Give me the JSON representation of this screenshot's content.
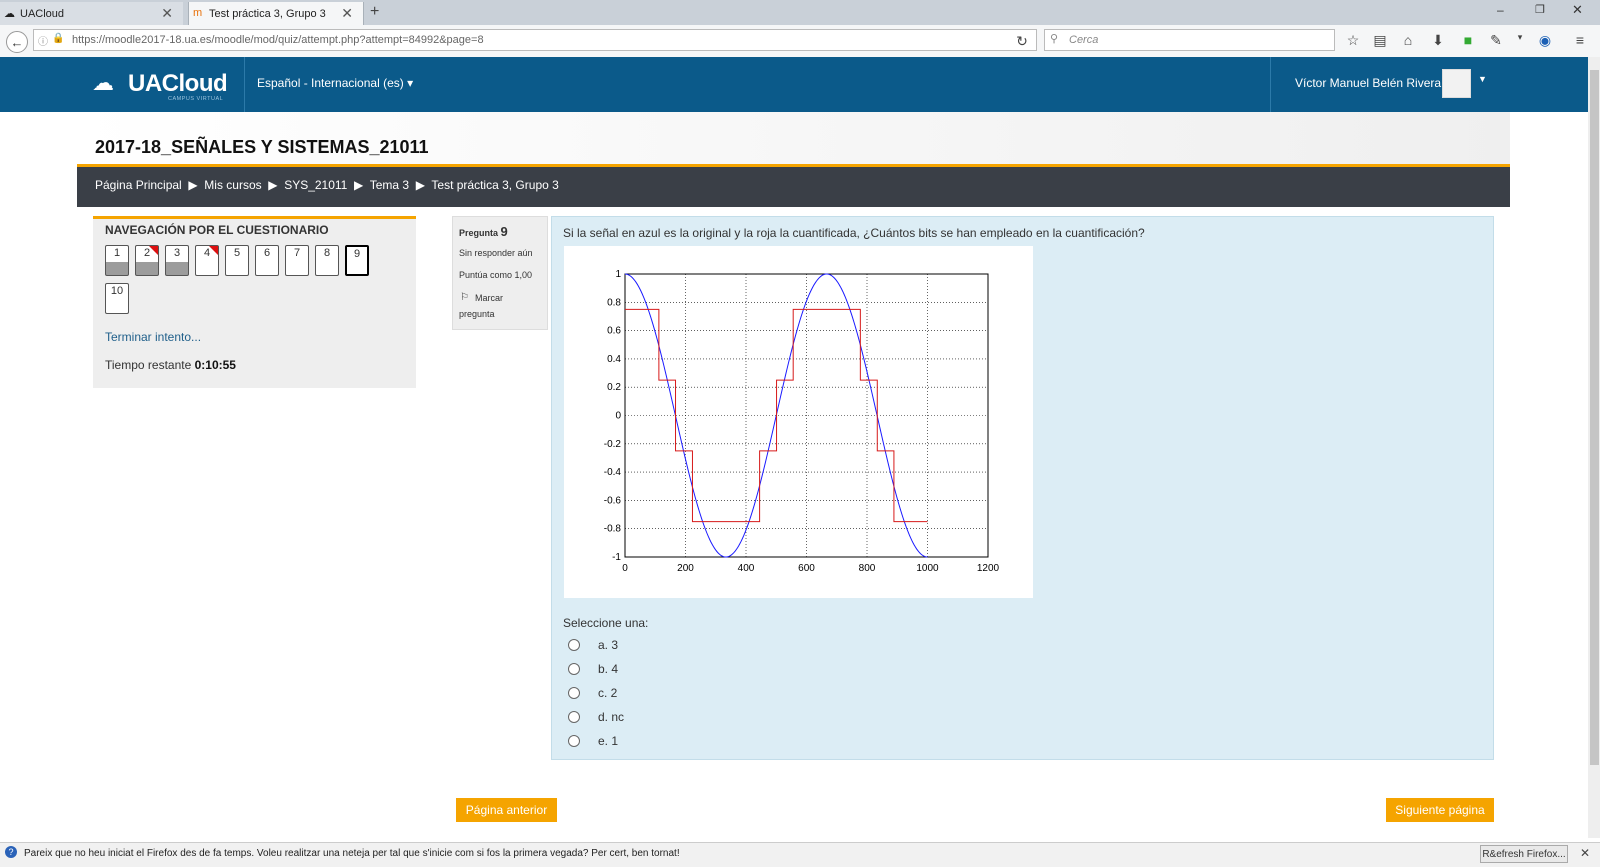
{
  "browser": {
    "tabs": [
      {
        "label": "UACloud",
        "active": false
      },
      {
        "label": "Test práctica 3, Grupo 3",
        "active": true
      }
    ],
    "url": "https://moodle2017-18.ua.es/moodle/mod/quiz/attempt.php?attempt=84992&page=8",
    "search_placeholder": "Cerca"
  },
  "header": {
    "logo": "UACloud",
    "logo_sub": "CAMPUS VIRTUAL",
    "language": "Español - Internacional (es) ▾",
    "user": "Víctor Manuel Belén Rivera"
  },
  "course_title": "2017-18_SEÑALES Y SISTEMAS_21011",
  "breadcrumb": "Página Principal  ▶  Mis cursos  ▶  SYS_21011  ▶  Tema 3  ▶  Test práctica 3, Grupo 3",
  "quiz_nav": {
    "title": "NAVEGACIÓN POR EL CUESTIONARIO",
    "questions": [
      "1",
      "2",
      "3",
      "4",
      "5",
      "6",
      "7",
      "8",
      "9",
      "10"
    ],
    "answered": [
      "1",
      "2",
      "3"
    ],
    "flagged": [
      "2",
      "4"
    ],
    "current": "9",
    "finish_label": "Terminar intento...",
    "time_label": "Tiempo restante ",
    "time_value": "0:10:55"
  },
  "question_info": {
    "label": "Pregunta ",
    "number": "9",
    "status": "Sin responder aún",
    "score": "Puntúa como 1,00",
    "flag_line1": "Marcar",
    "flag_line2": "pregunta"
  },
  "question": {
    "text": "Si la señal en azul es la original y la roja la cuantificada, ¿Cuántos bits se han empleado en la cuantificación?",
    "select_label": "Seleccione una:",
    "options": [
      "a. 3",
      "b. 4",
      "c. 2",
      "d. nc",
      "e. 1"
    ]
  },
  "chart_data": {
    "type": "line",
    "xlim": [
      0,
      1200
    ],
    "ylim": [
      -1,
      1
    ],
    "x_ticks": [
      "0",
      "200",
      "400",
      "600",
      "800",
      "1000",
      "1200"
    ],
    "y_ticks": [
      "1",
      "0.8",
      "0.6",
      "0.4",
      "0.2",
      "0",
      "-0.2",
      "-0.4",
      "-0.6",
      "-0.8",
      "-1"
    ],
    "grid": true,
    "series": [
      {
        "color": "#1a1aff",
        "x_end": 1000,
        "function": "cos",
        "period": 666.7
      },
      {
        "color": "#d61a1a",
        "levels": [
          0.75,
          0.25,
          -0.25,
          -0.75
        ],
        "x_end": 1000
      }
    ]
  },
  "buttons": {
    "prev": "Página anterior",
    "next": "Siguiente página"
  },
  "notification": {
    "text": "Pareix que no heu iniciat el Firefox des de fa temps. Voleu realitzar una neteja per tal que s'inicie com si fos la primera vegada? Per cert, ben tornat!",
    "button": "R&efresh Firefox..."
  }
}
